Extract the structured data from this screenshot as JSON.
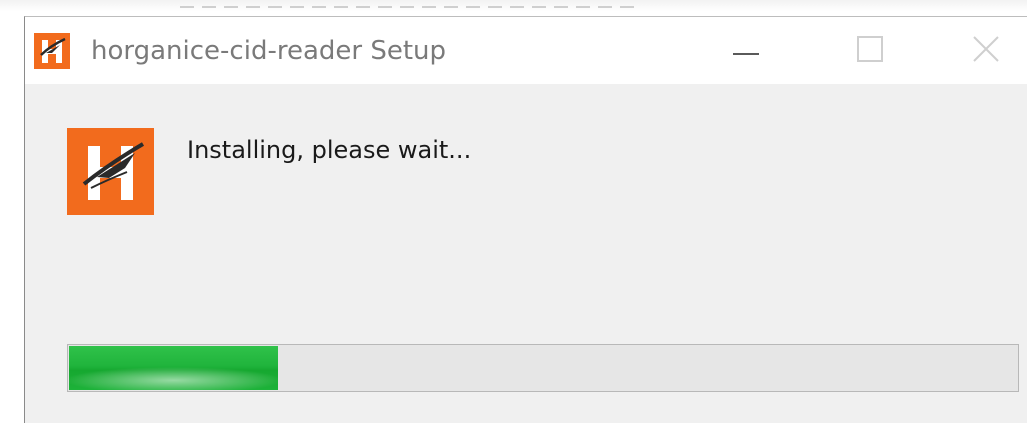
{
  "window": {
    "title": "horganice-cid-reader Setup",
    "controls": {
      "minimize": "minimize-icon",
      "maximize": "maximize-icon",
      "close": "close-icon"
    }
  },
  "content": {
    "status": "Installing, please wait..."
  },
  "progress": {
    "fraction": 0.22
  },
  "colors": {
    "brand_orange": "#f26b1d",
    "progress_green": "#1fb33a",
    "title_text": "#7a7a7a"
  },
  "icons": {
    "app": "horganice-logo-icon"
  }
}
